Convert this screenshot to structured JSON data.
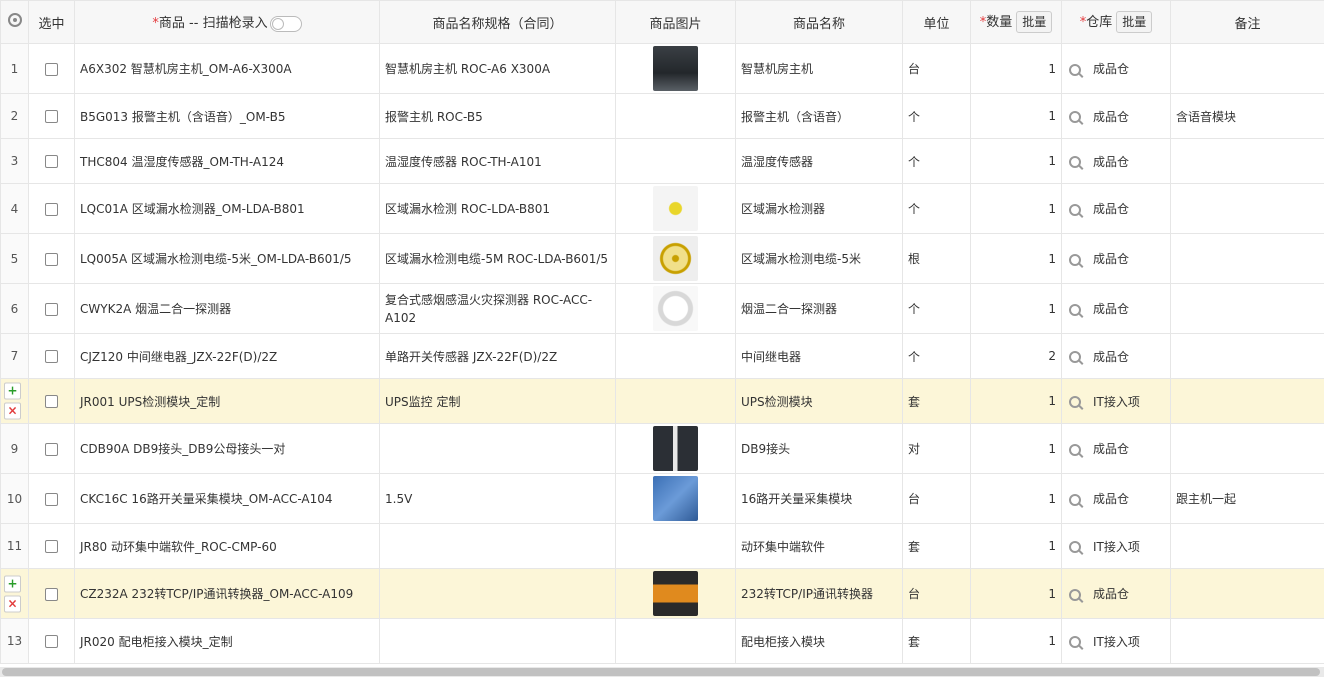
{
  "columns": {
    "checked": "选中",
    "product_prefix": "*",
    "product": "商品 -- 扫描枪录入",
    "spec": "商品名称规格（合同）",
    "image": "商品图片",
    "name": "商品名称",
    "unit": "单位",
    "qty_prefix": "*",
    "qty": "数量",
    "qty_batch": "批量",
    "warehouse_prefix": "*",
    "warehouse": "仓库",
    "warehouse_batch": "批量",
    "remark": "备注"
  },
  "colors": {
    "highlight_row": "#fcf6d8",
    "required": "#e4393c",
    "add": "#2a9d2a",
    "delete": "#e23b3b"
  },
  "rows": [
    {
      "idx": "1",
      "product": "A6X302 智慧机房主机_OM-A6-X300A",
      "spec": "智慧机房主机 ROC-A6 X300A",
      "image": "host-photo",
      "name": "智慧机房主机",
      "unit": "台",
      "qty": "1",
      "warehouse": "成品仓",
      "remark": ""
    },
    {
      "idx": "2",
      "product": "B5G013 报警主机（含语音）_OM-B5",
      "spec": "报警主机 ROC-B5",
      "image": "",
      "name": "报警主机（含语音）",
      "unit": "个",
      "qty": "1",
      "warehouse": "成品仓",
      "remark": "含语音模块"
    },
    {
      "idx": "3",
      "product": "THC804 温湿度传感器_OM-TH-A124",
      "spec": "温湿度传感器 ROC-TH-A101",
      "image": "",
      "name": "温湿度传感器",
      "unit": "个",
      "qty": "1",
      "warehouse": "成品仓",
      "remark": ""
    },
    {
      "idx": "4",
      "product": "LQC01A 区域漏水检测器_OM-LDA-B801",
      "spec": "区域漏水检测 ROC-LDA-B801",
      "image": "leak-detector-photo",
      "name": "区域漏水检测器",
      "unit": "个",
      "qty": "1",
      "warehouse": "成品仓",
      "remark": ""
    },
    {
      "idx": "5",
      "product": "LQ005A 区域漏水检测电缆-5米_OM-LDA-B601/5",
      "spec": "区域漏水检测电缆-5M ROC-LDA-B601/5",
      "image": "cable-photo",
      "name": "区域漏水检测电缆-5米",
      "unit": "根",
      "qty": "1",
      "warehouse": "成品仓",
      "remark": ""
    },
    {
      "idx": "6",
      "product": "CWYK2A 烟温二合一探测器",
      "spec": "复合式感烟感温火灾探测器 ROC-ACC-A102",
      "image": "smoke-detector-photo",
      "name": "烟温二合一探测器",
      "unit": "个",
      "qty": "1",
      "warehouse": "成品仓",
      "remark": ""
    },
    {
      "idx": "7",
      "product": "CJZ120 中间继电器_JZX-22F(D)/2Z",
      "spec": "单路开关传感器 JZX-22F(D)/2Z",
      "image": "",
      "name": "中间继电器",
      "unit": "个",
      "qty": "2",
      "warehouse": "成品仓",
      "remark": ""
    },
    {
      "idx": "",
      "product": "JR001 UPS检测模块_定制",
      "spec": "UPS监控 定制",
      "image": "",
      "name": "UPS检测模块",
      "unit": "套",
      "qty": "1",
      "warehouse": "IT接入项",
      "remark": "",
      "hl": true
    },
    {
      "idx": "9",
      "product": "CDB90A DB9接头_DB9公母接头一对",
      "spec": "",
      "image": "db9-photo",
      "name": "DB9接头",
      "unit": "对",
      "qty": "1",
      "warehouse": "成品仓",
      "remark": ""
    },
    {
      "idx": "10",
      "product": "CKC16C 16路开关量采集模块_OM-ACC-A104",
      "spec": "1.5V",
      "image": "module-photo",
      "name": "16路开关量采集模块",
      "unit": "台",
      "qty": "1",
      "warehouse": "成品仓",
      "remark": "跟主机一起"
    },
    {
      "idx": "11",
      "product": "JR80 动环集中端软件_ROC-CMP-60",
      "spec": "",
      "image": "",
      "name": "动环集中端软件",
      "unit": "套",
      "qty": "1",
      "warehouse": "IT接入项",
      "remark": ""
    },
    {
      "idx": "",
      "product": "CZ232A 232转TCP/IP通讯转换器_OM-ACC-A109",
      "spec": "",
      "image": "converter-photo",
      "name": "232转TCP/IP通讯转换器",
      "unit": "台",
      "qty": "1",
      "warehouse": "成品仓",
      "remark": "",
      "hl": true
    },
    {
      "idx": "13",
      "product": "JR020 配电柜接入模块_定制",
      "spec": "",
      "image": "",
      "name": "配电柜接入模块",
      "unit": "套",
      "qty": "1",
      "warehouse": "IT接入项",
      "remark": ""
    }
  ]
}
